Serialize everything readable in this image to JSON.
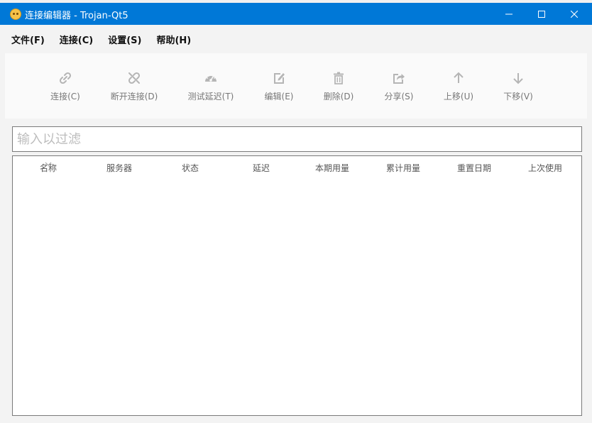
{
  "window": {
    "title": "连接编辑器 - Trojan-Qt5"
  },
  "menu": [
    "文件(F)",
    "连接(C)",
    "设置(S)",
    "帮助(H)"
  ],
  "toolbar": [
    {
      "label": "连接(C)",
      "icon": "link-icon"
    },
    {
      "label": "断开连接(D)",
      "icon": "unlink-icon"
    },
    {
      "label": "测试延迟(T)",
      "icon": "speedometer-icon"
    },
    {
      "label": "编辑(E)",
      "icon": "edit-icon"
    },
    {
      "label": "删除(D)",
      "icon": "trash-icon"
    },
    {
      "label": "分享(S)",
      "icon": "share-icon"
    },
    {
      "label": "上移(U)",
      "icon": "arrow-up-icon"
    },
    {
      "label": "下移(V)",
      "icon": "arrow-down-icon"
    }
  ],
  "filter": {
    "placeholder": "输入以过滤",
    "value": ""
  },
  "table": {
    "columns": [
      "名称",
      "服务器",
      "状态",
      "延迟",
      "本期用量",
      "累计用量",
      "重置日期",
      "上次使用"
    ],
    "rows": []
  },
  "colors": {
    "titlebar": "#0078d7",
    "icon": "#b5b5b5",
    "label": "#777777"
  }
}
